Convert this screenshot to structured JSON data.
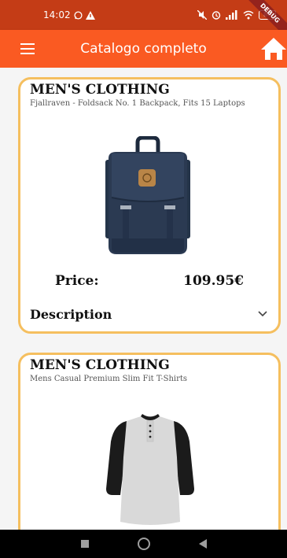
{
  "status_bar": {
    "time": "14:02",
    "battery": "84",
    "debug_banner": "DEBUG"
  },
  "app_bar": {
    "title": "Catalogo completo"
  },
  "products": [
    {
      "category": "MEN'S CLOTHING",
      "title": "Fjallraven - Foldsack No. 1 Backpack, Fits 15 Laptops",
      "price_label": "Price:",
      "price": "109.95€",
      "description_label": "Description"
    },
    {
      "category": "MEN'S CLOTHING",
      "title": "Mens Casual Premium Slim Fit T-Shirts"
    }
  ],
  "colors": {
    "status_bar": "#c43c16",
    "app_bar": "#fa5a22",
    "card_border": "#f5bf5f"
  }
}
